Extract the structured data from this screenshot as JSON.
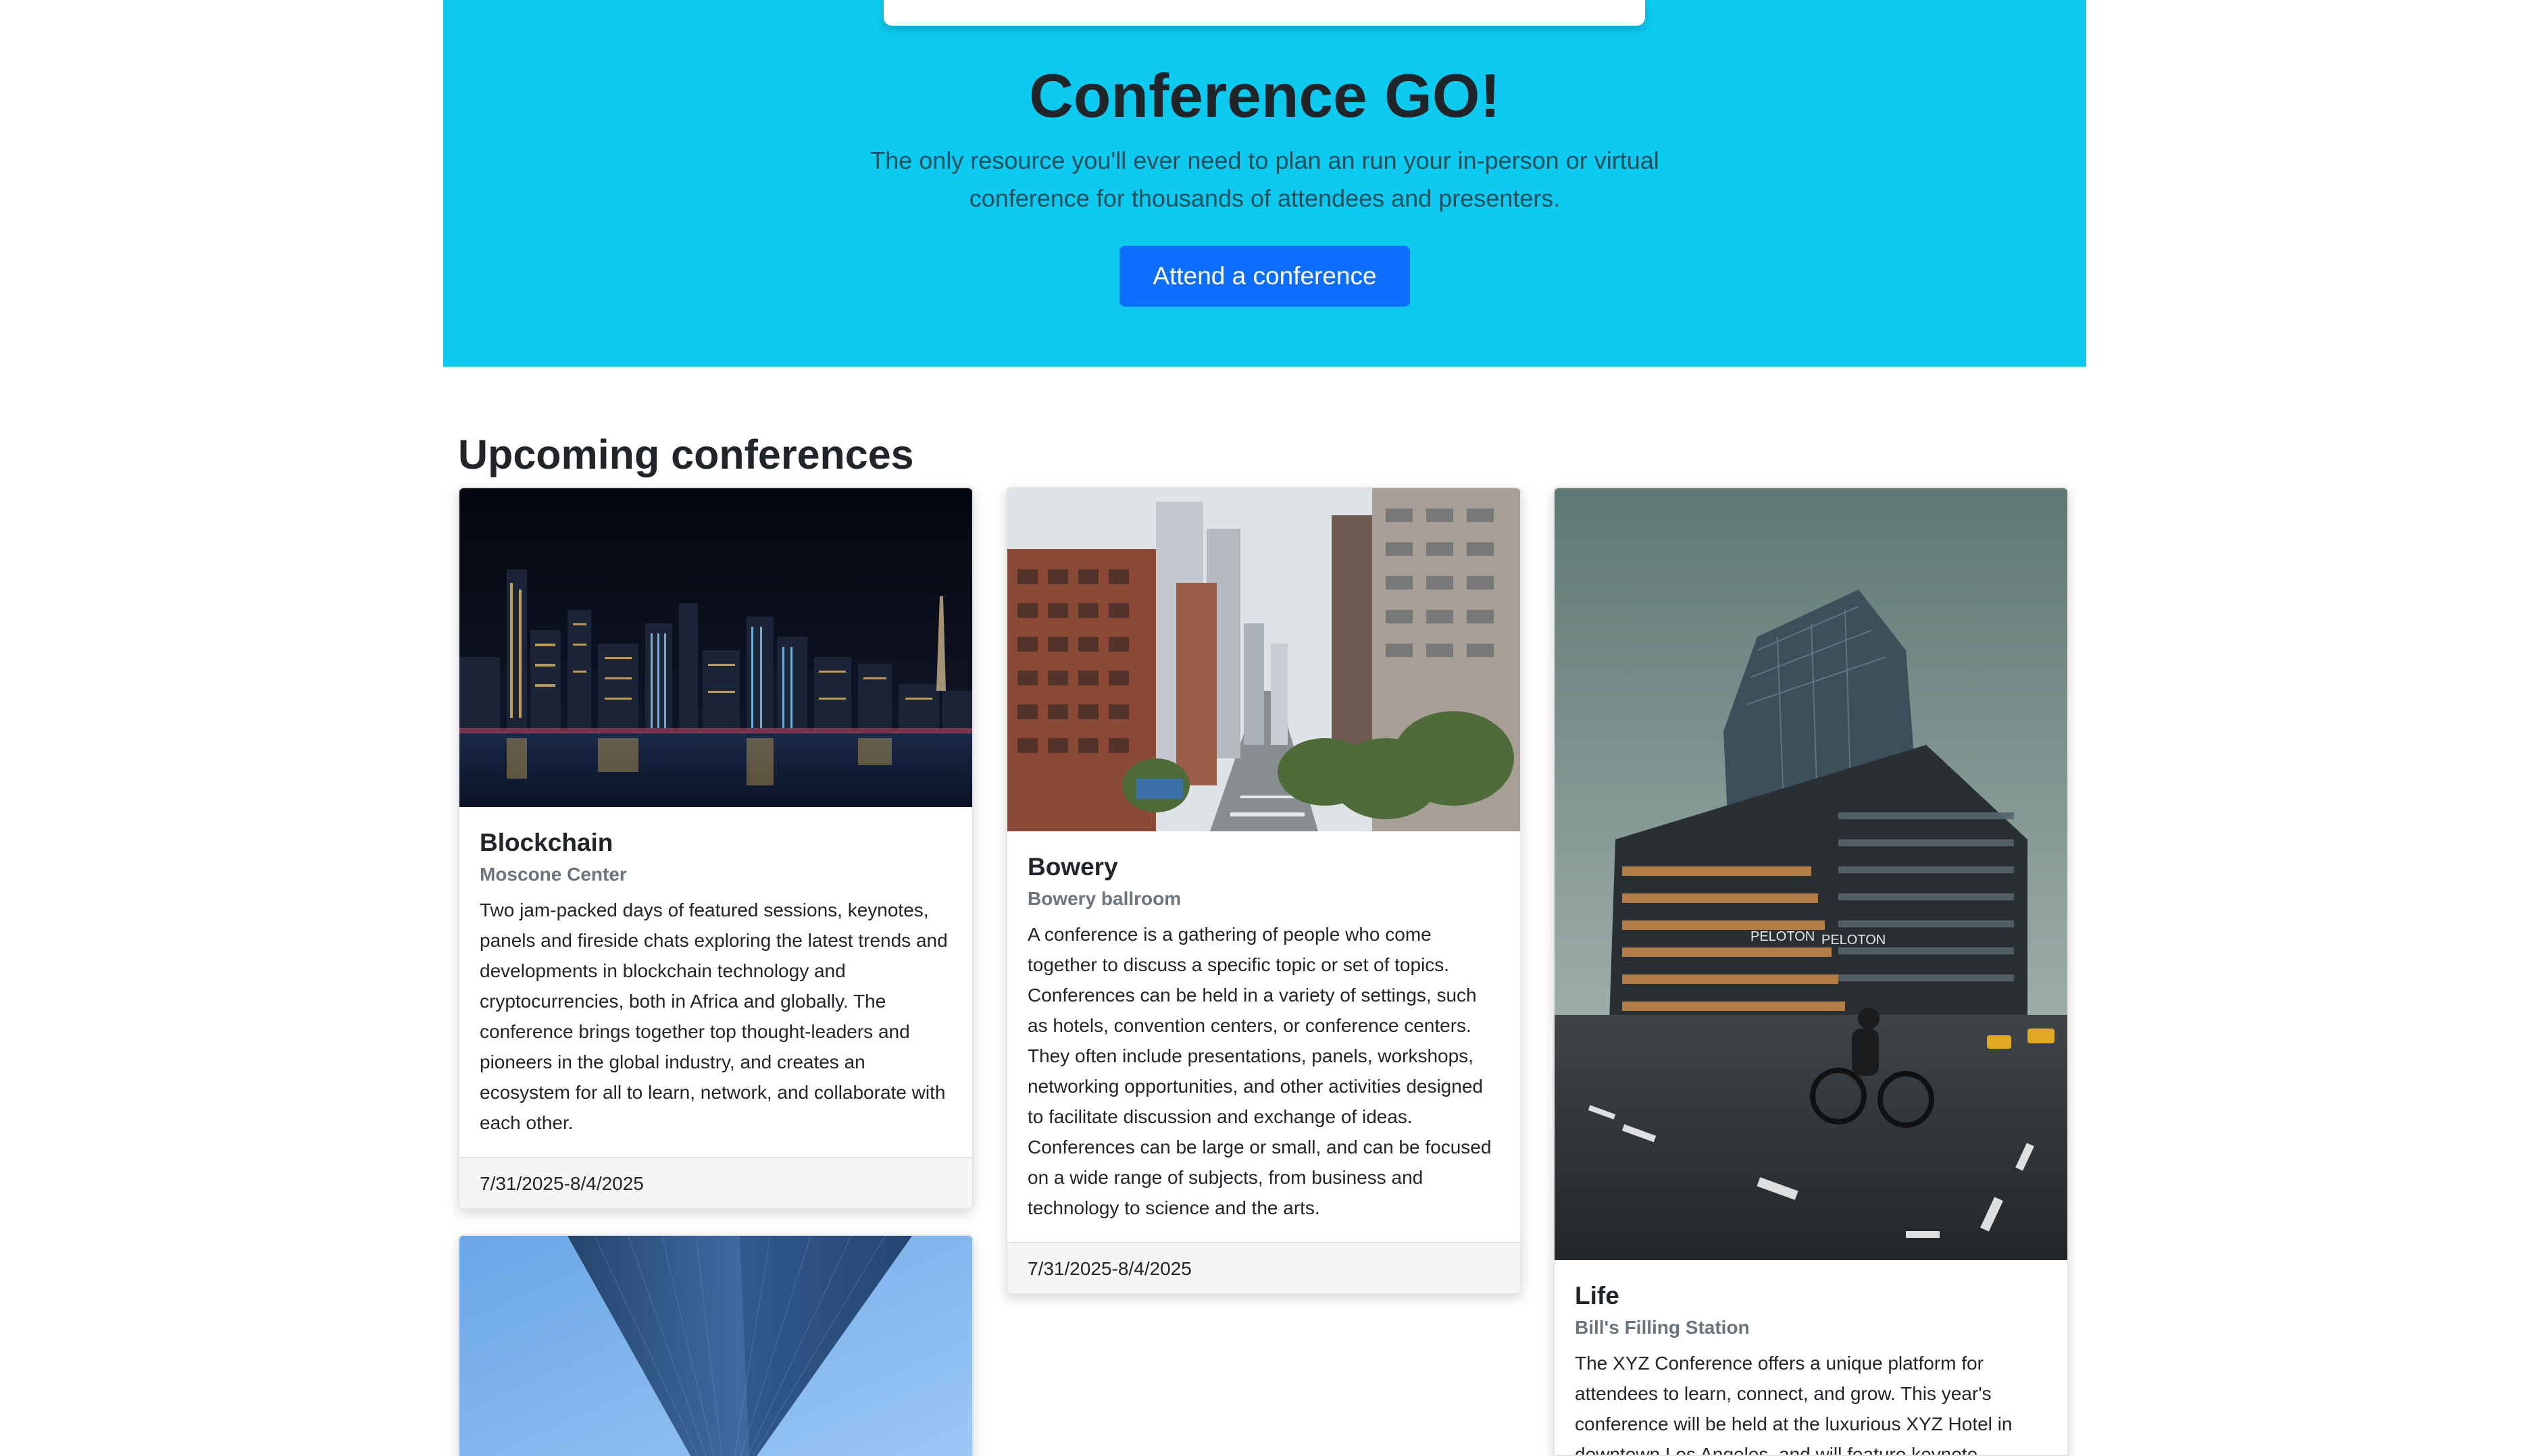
{
  "hero": {
    "title": "Conference GO!",
    "lead": "The only resource you'll ever need to plan an run your in-person or virtual conference for thousands of attendees and presenters.",
    "cta_label": "Attend a conference",
    "background_color": "#0dcaf0",
    "button_color": "#0d6efd"
  },
  "section": {
    "heading": "Upcoming conferences"
  },
  "conferences": [
    {
      "name": "Blockchain",
      "location": "Moscone Center",
      "description": "Two jam-packed days of featured sessions, keynotes, panels and fireside chats exploring the latest trends and developments in blockchain technology and cryptocurrencies, both in Africa and globally. The conference brings together top thought-leaders and pioneers in the global industry, and creates an ecosystem for all to learn, network, and collaborate with each other.",
      "dates": "7/31/2025-8/4/2025",
      "image": "night-city-skyline-photo"
    },
    {
      "name": "Bowery",
      "location": "Bowery ballroom",
      "description": "A conference is a gathering of people who come together to discuss a specific topic or set of topics. Conferences can be held in a variety of settings, such as hotels, convention centers, or conference centers. They often include presentations, panels, workshops, networking opportunities, and other activities designed to facilitate discussion and exchange of ideas. Conferences can be large or small, and can be focused on a wide range of subjects, from business and technology to science and the arts.",
      "dates": "7/31/2025-8/4/2025",
      "image": "city-street-buildings-photo"
    },
    {
      "name": "Life",
      "location": "Bill's Filling Station",
      "description": "The XYZ Conference offers a unique platform for attendees to learn, connect, and grow. This year's conference will be held at the luxurious XYZ Hotel in downtown Los Angeles, and will feature keynote",
      "dates": "",
      "image": "office-building-cyclist-photo",
      "building_signs": [
        "PELOTON",
        "PELOTON"
      ]
    },
    {
      "name": "",
      "location": "",
      "description": "",
      "dates": "",
      "image": "glass-tower-looking-up-photo"
    }
  ]
}
